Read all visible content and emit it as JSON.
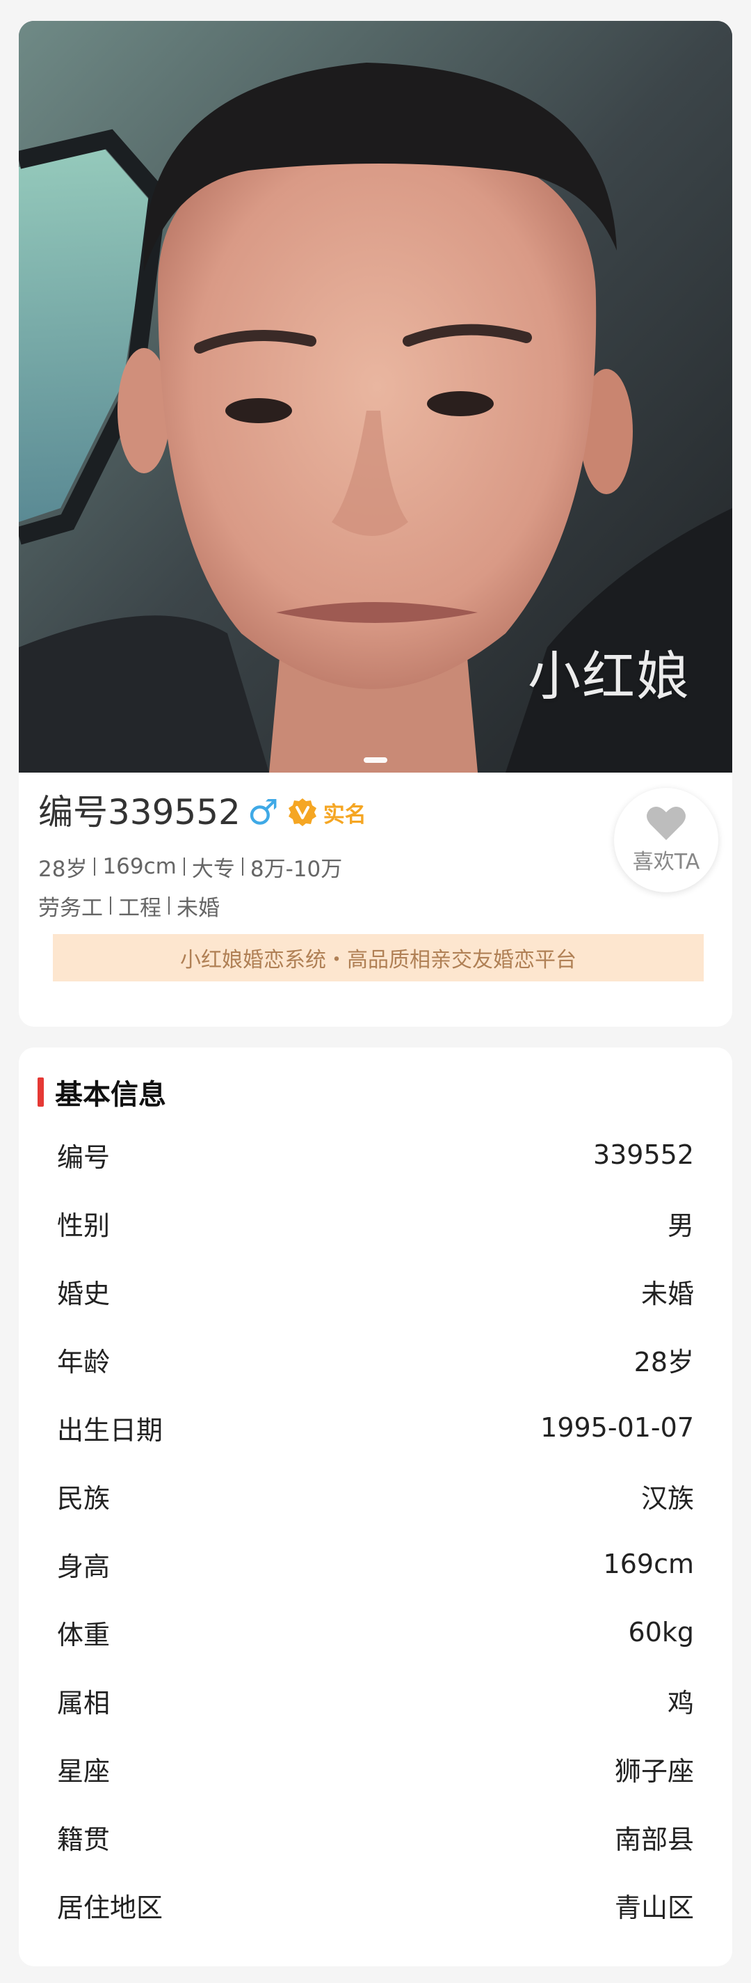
{
  "photo": {
    "watermark": "小红娘",
    "slide_count": 1
  },
  "profile": {
    "id_prefix": "编号",
    "id_number": "339552",
    "gender_symbol": "♂",
    "verify_label": "实名",
    "meta_line1": [
      "28岁",
      "169cm",
      "大专",
      "8万-10万"
    ],
    "meta_line2": [
      "劳务工",
      "工程",
      "未婚"
    ],
    "like_label": "喜欢TA",
    "banner": "小红娘婚恋系统・高品质相亲交友婚恋平台"
  },
  "basic_info": {
    "title": "基本信息",
    "rows": [
      {
        "label": "编号",
        "value": "339552"
      },
      {
        "label": "性别",
        "value": "男"
      },
      {
        "label": "婚史",
        "value": "未婚"
      },
      {
        "label": "年龄",
        "value": "28岁"
      },
      {
        "label": "出生日期",
        "value": "1995-01-07"
      },
      {
        "label": "民族",
        "value": "汉族"
      },
      {
        "label": "身高",
        "value": "169cm"
      },
      {
        "label": "体重",
        "value": "60kg"
      },
      {
        "label": "属相",
        "value": "鸡"
      },
      {
        "label": "星座",
        "value": "狮子座"
      },
      {
        "label": "籍贯",
        "value": "南部县"
      },
      {
        "label": "居住地区",
        "value": "青山区"
      }
    ]
  },
  "colors": {
    "page_bg": "#f5f5f5",
    "accent_red": "#e53935",
    "gender_blue": "#3fa9e6",
    "verify_orange": "#f5a623",
    "banner_bg": "#fde6cf",
    "banner_text": "#b08055"
  },
  "icons": {
    "gender": "male-symbol-icon",
    "verify": "verified-v-badge-icon",
    "like": "heart-icon"
  }
}
